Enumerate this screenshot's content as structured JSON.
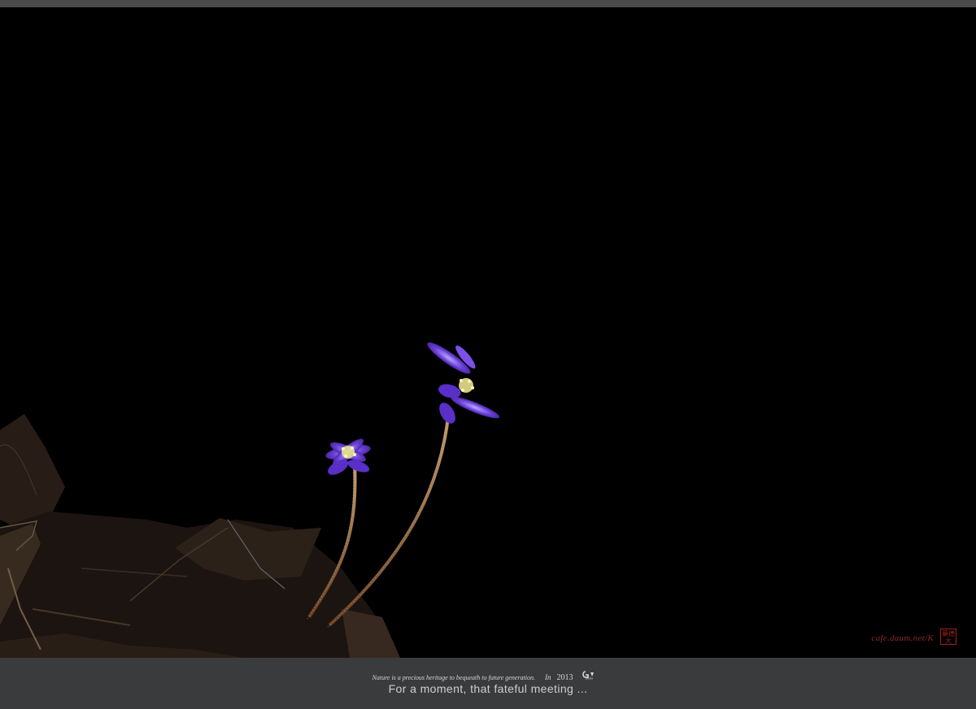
{
  "footer": {
    "motto": "Nature is a precious heritage to bequeath to future generation.",
    "year_prefix": "In",
    "year": "2013",
    "caption": "For a moment, that fateful meeting ..."
  },
  "watermark": {
    "text": "cafe.daum.net/K",
    "seal_text": "藥德大"
  },
  "photo": {
    "subject": "purple-hepatica-flowers",
    "colors": {
      "background": "#000000",
      "petal": "#6a3fd8",
      "stamen": "#e8e090",
      "stem": "#9a6a3a",
      "frame": "#3a3b3c"
    }
  }
}
